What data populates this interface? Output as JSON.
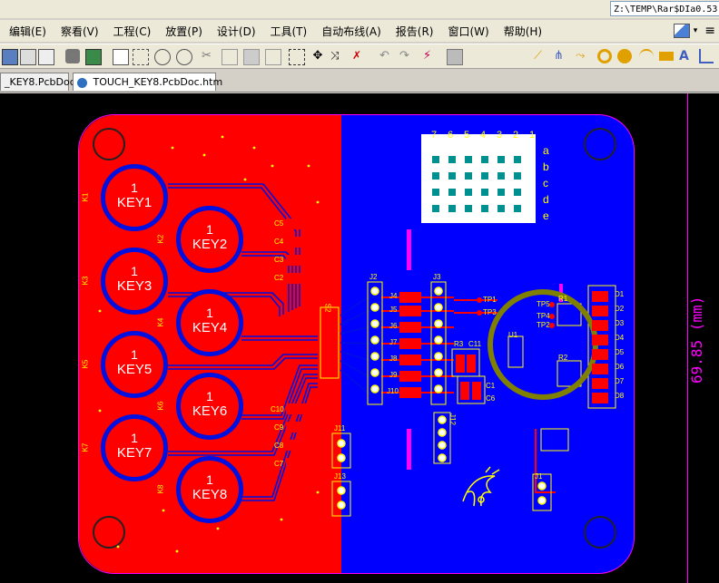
{
  "path_bar": {
    "text": "Z:\\TEMP\\Rar$DIa0.53"
  },
  "menu": [
    {
      "label": "编辑(E)"
    },
    {
      "label": "察看(V)"
    },
    {
      "label": "工程(C)"
    },
    {
      "label": "放置(P)"
    },
    {
      "label": "设计(D)"
    },
    {
      "label": "工具(T)"
    },
    {
      "label": "自动布线(A)"
    },
    {
      "label": "报告(R)"
    },
    {
      "label": "窗口(W)"
    },
    {
      "label": "帮助(H)"
    }
  ],
  "tabs": [
    {
      "label": "_KEY8.PcbDoc"
    },
    {
      "label": "TOUCH_KEY8.PcbDoc.htm"
    }
  ],
  "pcb": {
    "keys": [
      {
        "num": "1",
        "label": "KEY1"
      },
      {
        "num": "1",
        "label": "KEY2"
      },
      {
        "num": "1",
        "label": "KEY3"
      },
      {
        "num": "1",
        "label": "KEY4"
      },
      {
        "num": "1",
        "label": "KEY5"
      },
      {
        "num": "1",
        "label": "KEY6"
      },
      {
        "num": "1",
        "label": "KEY7"
      },
      {
        "num": "1",
        "label": "KEY8"
      }
    ],
    "k_labels": [
      "K1",
      "K2",
      "K3",
      "K4",
      "K5",
      "K6",
      "K7",
      "K8"
    ],
    "caps_upper": [
      "C5",
      "C4",
      "C3",
      "C2"
    ],
    "caps_lower": [
      "C10",
      "C9",
      "C8",
      "C7"
    ],
    "connectors": [
      "J2",
      "J3",
      "J11",
      "J12",
      "J13",
      "J1"
    ],
    "jumpers": [
      "J4",
      "J5",
      "J6",
      "J7",
      "J8",
      "J9",
      "J10"
    ],
    "tp_left": [
      "TP1",
      "TP3"
    ],
    "tp_right": [
      "TP5",
      "TP4",
      "TP2"
    ],
    "misc_labels": [
      "R3",
      "C11",
      "C1",
      "C6",
      "R1",
      "R2",
      "U1",
      "S2"
    ],
    "d_labels": [
      "D1",
      "D2",
      "D3",
      "D4",
      "D5",
      "D6",
      "D7",
      "D8"
    ],
    "matrix_cols": [
      "7",
      "6",
      "5",
      "4",
      "3",
      "2",
      "1"
    ],
    "matrix_rows": [
      "a",
      "b",
      "c",
      "d",
      "e"
    ],
    "dimension": "69.85 (mm)"
  },
  "colors": {
    "top_copper": "#ff0000",
    "bottom_copper": "#0000ff",
    "outline": "#ff00ff",
    "silk": "#ffff00"
  }
}
